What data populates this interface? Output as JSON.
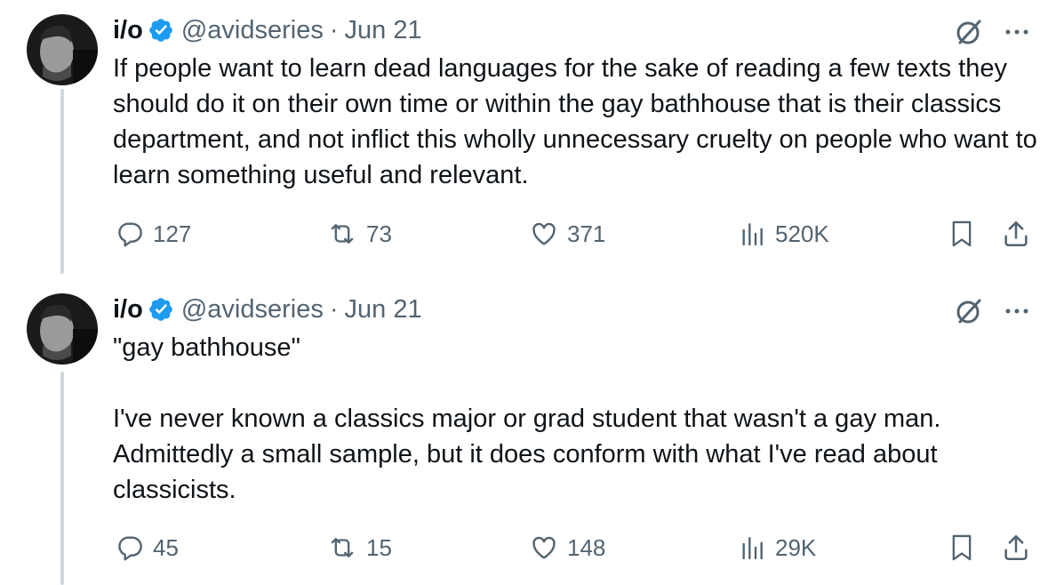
{
  "tweets": [
    {
      "name": "i/o",
      "handle": "@avidseries",
      "separator": "·",
      "date": "Jun 21",
      "text": "If people want to learn dead languages for the sake of reading a few texts they should do it on their own time or within the gay bathhouse that is their classics department, and not inflict this wholly unnecessary cruelty on people who want to learn something useful and relevant.",
      "replies": "127",
      "reposts": "73",
      "likes": "371",
      "views": "520K"
    },
    {
      "name": "i/o",
      "handle": "@avidseries",
      "separator": "·",
      "date": "Jun 21",
      "text": "\"gay bathhouse\"\n\nI've never known a classics major or grad student that wasn't a gay man. Admittedly a small sample, but it does conform with what I've read about classicists.",
      "replies": "45",
      "reposts": "15",
      "likes": "148",
      "views": "29K"
    }
  ],
  "icons": {
    "verified": "verified-badge-icon",
    "grok": "grok-icon",
    "more": "more-icon",
    "reply": "reply-icon",
    "repost": "repost-icon",
    "like": "like-icon",
    "views": "views-icon",
    "bookmark": "bookmark-icon",
    "share": "share-icon"
  },
  "colors": {
    "text": "#0f1419",
    "secondary": "#536471",
    "verified": "#1d9bf0",
    "thread_line": "#cfd9de"
  }
}
